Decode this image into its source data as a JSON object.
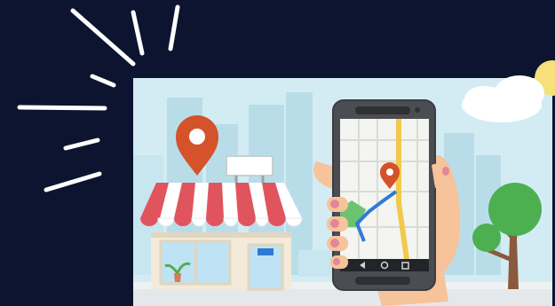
{
  "scene": {
    "background_color": "#0c1430",
    "panel_color": "#d3ecf3",
    "burst_color": "#ffffff",
    "pin_color": "#d4532b",
    "awning_red": "#e0545e",
    "awning_white": "#ffffff",
    "phone_body_color": "#4a4d52",
    "route_color": "#2f7ad6",
    "road_yellow": "#f2c94c",
    "hand_color": "#f6c39a",
    "tree_green": "#4caf50"
  },
  "icons": {
    "burst": "sparkle-lines-icon",
    "store": "storefront-icon",
    "store_pin": "map-pin-icon",
    "phone": "smartphone-icon",
    "phone_pin": "map-pin-icon",
    "nav_back": "triangle-back-icon",
    "nav_home": "circle-home-icon",
    "nav_recent": "square-recent-icon",
    "tree": "tree-icon",
    "cloud": "cloud-icon"
  }
}
